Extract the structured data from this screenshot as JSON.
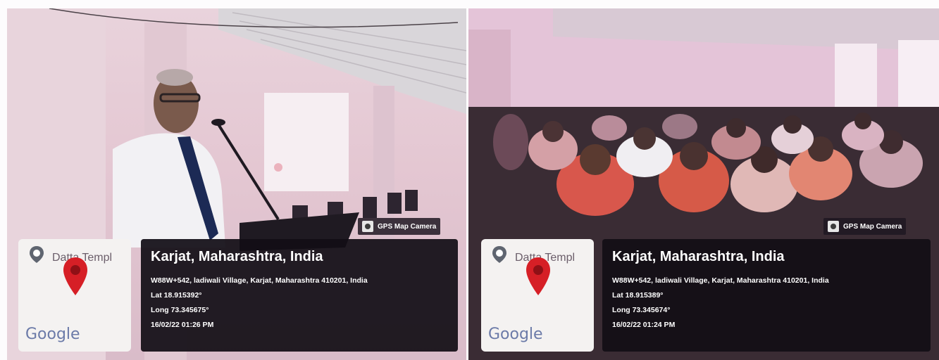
{
  "photos": [
    {
      "gps_label": "GPS Map Camera",
      "map": {
        "place_label": "Datta Templ",
        "logo": "Google"
      },
      "info": {
        "title": "Karjat, Maharashtra, India",
        "address": "W88W+542, ladiwali Village, Karjat, Maharashtra 410201, India",
        "lat": "Lat 18.915392°",
        "long": "Long 73.345675°",
        "datetime": "16/02/22 01:26 PM"
      }
    },
    {
      "gps_label": "GPS Map Camera",
      "map": {
        "place_label": "Datta Templ",
        "logo": "Google"
      },
      "info": {
        "title": "Karjat, Maharashtra, India",
        "address": "W88W+542, ladiwali Village, Karjat, Maharashtra 410201, India",
        "lat": "Lat 18.915389°",
        "long": "Long 73.345674°",
        "datetime": "16/02/22 01:24 PM"
      }
    }
  ],
  "icons": [
    "camera-icon",
    "location-icon",
    "map-pin-icon"
  ],
  "colors": {
    "overlay": "#120e16",
    "pin": "#d61f26",
    "map_bg": "#f4f2f1"
  }
}
